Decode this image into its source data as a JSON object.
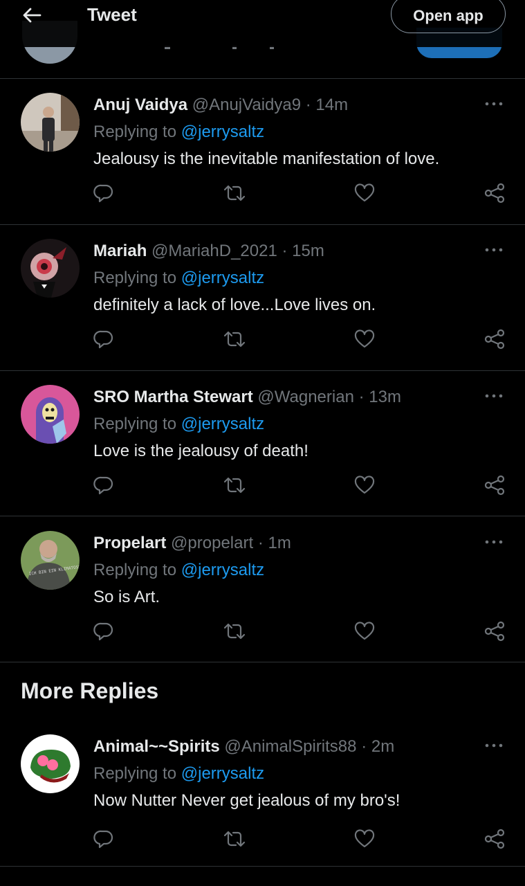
{
  "header": {
    "title": "Tweet",
    "open_app_label": "Open app"
  },
  "replies": [
    {
      "name": "Anuj Vaidya",
      "handle": "@AnujVaidya9",
      "time": "14m",
      "replying_prefix": "Replying to",
      "replying_handle": "@jerrysaltz",
      "text": "Jealousy is the inevitable manifestation of love."
    },
    {
      "name": "Mariah",
      "handle": "@MariahD_2021",
      "time": "15m",
      "replying_prefix": "Replying to",
      "replying_handle": "@jerrysaltz",
      "text": "definitely a lack of love...Love lives on."
    },
    {
      "name": "SRO Martha Stewart",
      "handle": "@Wagnerian",
      "time": "13m",
      "replying_prefix": "Replying to",
      "replying_handle": "@jerrysaltz",
      "text": "Love is the jealousy of death!"
    },
    {
      "name": "Propelart",
      "handle": "@propelart",
      "time": "1m",
      "replying_prefix": "Replying to",
      "replying_handle": "@jerrysaltz",
      "text": "So is Art.",
      "avatar_shirt_text": "ICH BIN EIN KLIMATOSSER"
    }
  ],
  "more_replies": {
    "heading": "More Replies",
    "items": [
      {
        "name": "Animal~~Spirits",
        "handle": "@AnimalSpirits88",
        "time": "2m",
        "replying_prefix": "Replying to",
        "replying_handle": "@jerrysaltz",
        "text": "Now Nutter Never get jealous of my bro's!"
      }
    ]
  },
  "colors": {
    "background": "#000000",
    "primary_text": "#e7e9ea",
    "secondary_text": "#71767b",
    "link": "#1d9bf0",
    "divider": "#2f3336"
  },
  "icons": [
    "back-arrow-icon",
    "more-icon",
    "reply-icon",
    "retweet-icon",
    "like-icon",
    "share-icon"
  ]
}
